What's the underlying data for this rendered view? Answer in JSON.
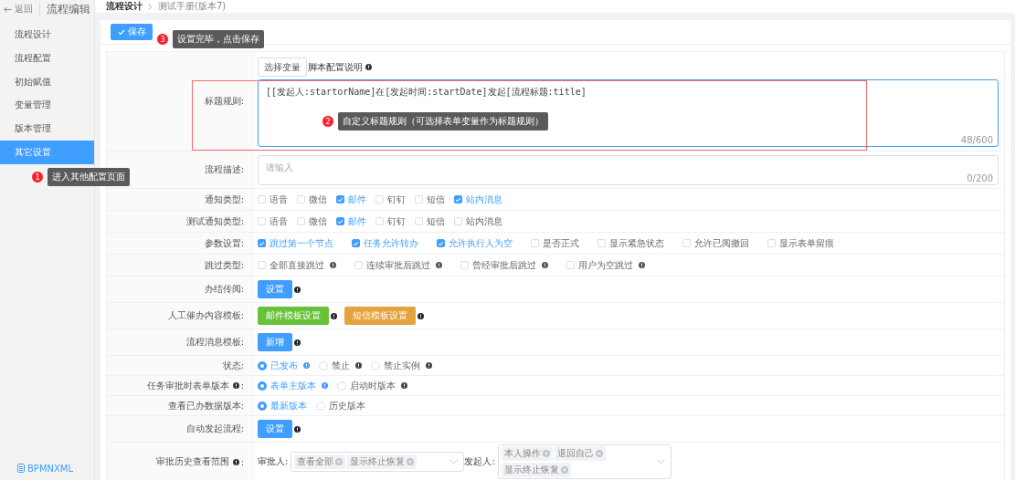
{
  "header": {
    "back": "返回",
    "title": "流程编辑",
    "breadcrumb": [
      "流程设计",
      "测试手册(版本7)"
    ]
  },
  "sidebar": {
    "items": [
      {
        "label": "流程设计",
        "selected": false
      },
      {
        "label": "流程配置",
        "selected": false
      },
      {
        "label": "初始赋值",
        "selected": false
      },
      {
        "label": "变量管理",
        "selected": false
      },
      {
        "label": "版本管理",
        "selected": false
      },
      {
        "label": "其它设置",
        "selected": true
      }
    ],
    "footer": "BPMNXML"
  },
  "toolbar": {
    "save": "保存"
  },
  "form": {
    "rows": [
      {
        "kind": "title_rule",
        "label": "标题规则:",
        "button": "选择变量",
        "note": "脚本配置说明",
        "value": "[[发起人:startorName]在[发起时间:startDate]发起[流程标题:title]",
        "counter": "48/600"
      },
      {
        "kind": "textarea",
        "label": "流程描述:",
        "placeholder": "请输入",
        "counter": "0/200"
      },
      {
        "kind": "checkboxes",
        "label": "通知类型:",
        "options": [
          {
            "label": "语音",
            "checked": false,
            "info": false
          },
          {
            "label": "微信",
            "checked": false,
            "info": false
          },
          {
            "label": "邮件",
            "checked": true,
            "info": false
          },
          {
            "label": "钉钉",
            "checked": false,
            "info": false
          },
          {
            "label": "短信",
            "checked": false,
            "info": false
          },
          {
            "label": "站内消息",
            "checked": true,
            "info": false
          }
        ]
      },
      {
        "kind": "checkboxes",
        "label": "测试通知类型:",
        "options": [
          {
            "label": "语音",
            "checked": false,
            "info": false
          },
          {
            "label": "微信",
            "checked": false,
            "info": false
          },
          {
            "label": "邮件",
            "checked": true,
            "info": false
          },
          {
            "label": "钉钉",
            "checked": false,
            "info": false
          },
          {
            "label": "短信",
            "checked": false,
            "info": false
          },
          {
            "label": "站内消息",
            "checked": false,
            "info": false
          }
        ]
      },
      {
        "kind": "checkboxes",
        "label": "参数设置:",
        "options": [
          {
            "label": "跳过第一个节点",
            "checked": true,
            "info": false
          },
          {
            "label": "任务允许转办",
            "checked": true,
            "info": false
          },
          {
            "label": "允许执行人为空",
            "checked": true,
            "info": false
          },
          {
            "label": "是否正式",
            "checked": false,
            "info": false
          },
          {
            "label": "显示紧急状态",
            "checked": false,
            "info": false
          },
          {
            "label": "允许已阅撤回",
            "checked": false,
            "info": false
          },
          {
            "label": "显示表单留痕",
            "checked": false,
            "info": false
          }
        ]
      },
      {
        "kind": "checkboxes",
        "label": "跳过类型:",
        "options": [
          {
            "label": "全部直接跳过",
            "checked": false,
            "info": true
          },
          {
            "label": "连续审批后跳过",
            "checked": false,
            "info": true
          },
          {
            "label": "曾经审批后跳过",
            "checked": false,
            "info": true
          },
          {
            "label": "用户为空跳过",
            "checked": false,
            "info": true
          }
        ]
      },
      {
        "kind": "buttons",
        "label": "办结传阅:",
        "buttons": [
          {
            "label": "设置",
            "color": "#409eff"
          }
        ]
      },
      {
        "kind": "buttons",
        "label": "人工催办内容模板:",
        "buttons": [
          {
            "label": "邮件模板设置",
            "color": "#67c23a"
          },
          {
            "label": "短信模板设置",
            "color": "#e6a23c"
          }
        ]
      },
      {
        "kind": "buttons",
        "label": "流程消息模板:",
        "buttons": [
          {
            "label": "新增",
            "color": "#409eff"
          }
        ]
      },
      {
        "kind": "radios",
        "label": "状态:",
        "options": [
          {
            "label": "已发布",
            "selected": true,
            "info": true
          },
          {
            "label": "禁止",
            "selected": false,
            "info": true
          },
          {
            "label": "禁止实例",
            "selected": false,
            "info": true
          }
        ]
      },
      {
        "kind": "radios",
        "label": "任务审批时表单版本",
        "label_tail": ":",
        "options": [
          {
            "label": "表单主版本",
            "selected": true,
            "info": true
          },
          {
            "label": "启动时版本",
            "selected": false,
            "info": true
          }
        ]
      },
      {
        "kind": "radios",
        "label": "查看已办数据版本:",
        "options": [
          {
            "label": "最新版本",
            "selected": true,
            "info": false
          },
          {
            "label": "历史版本",
            "selected": false,
            "info": false
          }
        ]
      },
      {
        "kind": "buttons",
        "label": "自动发起流程:",
        "buttons": [
          {
            "label": "设置",
            "color": "#409eff"
          }
        ]
      },
      {
        "kind": "selects",
        "label": "审批历史查看范围",
        "label_tail": ":",
        "fields": [
          {
            "label": "审批人:",
            "tags": [
              "查看全部",
              "显示终止恢复"
            ]
          },
          {
            "label": "发起人:",
            "tags": [
              "本人操作",
              "退回自己",
              "显示终止恢复"
            ]
          }
        ]
      }
    ]
  },
  "annotations": [
    {
      "number": "1",
      "text": "进入其他配置页面"
    },
    {
      "number": "2",
      "text": "自定义标题规则（可选择表单变量作为标题规则）"
    },
    {
      "number": "3",
      "text": "设置完毕，点击保存"
    }
  ]
}
